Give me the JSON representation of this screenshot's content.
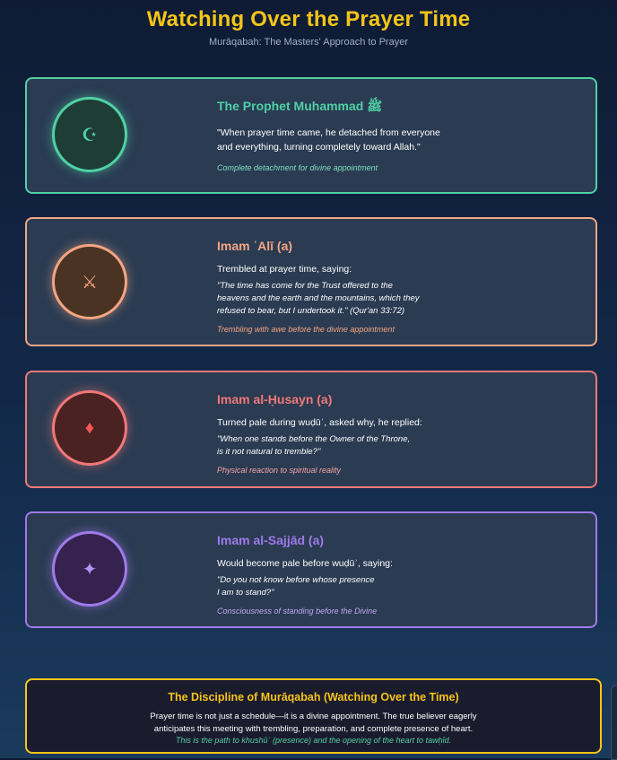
{
  "header": {
    "title": "Watching Over the Prayer Time",
    "subtitle": "Murāqabah: The Masters' Approach to Prayer"
  },
  "colors": {
    "gold": "#f5c518",
    "prophet": "#4fd1a5",
    "ali": "#f4a582",
    "husayn": "#f17878",
    "sajjad": "#9f7aea"
  },
  "cards": [
    {
      "icon": "crescent-star-icon",
      "glyph": "☪",
      "name": "The Prophet Muhammad ﷺ",
      "lead_lines": [
        "\"When prayer time came, he detached from everyone",
        "and everything, turning completely toward Allah.\""
      ],
      "quote_lines": [],
      "note": "Complete detachment for divine appointment"
    },
    {
      "icon": "crossed-swords-icon",
      "glyph": "⚔",
      "name": "Imam ʿAlī (a)",
      "lead_lines": [
        "Trembled at prayer time, saying:"
      ],
      "quote_lines": [
        "\"The time has come for the Trust offered to the",
        "heavens and the earth and the mountains, which they",
        "refused to bear, but I undertook it.\" (Qur'an 33:72)"
      ],
      "note": "Trembling with awe before the divine appointment"
    },
    {
      "icon": "diamond-icon",
      "glyph": "♦",
      "name": "Imam al-Ḥusayn (a)",
      "lead_lines": [
        "Turned pale during wuḍūʾ, asked why, he replied:"
      ],
      "quote_lines": [
        "\"When one stands before the Owner of the Throne,",
        "is it not natural to tremble?\""
      ],
      "note": "Physical reaction to spiritual reality"
    },
    {
      "icon": "sparkle-icon",
      "glyph": "✦",
      "name": "Imam al-Sajjād (a)",
      "lead_lines": [
        "Would become pale before wuḍūʾ, saying:"
      ],
      "quote_lines": [
        "\"Do you not know before whose presence",
        "I am to stand?\""
      ],
      "note": "Consciousness of standing before the Divine"
    }
  ],
  "discipline": {
    "title": "The Discipline of Murāqabah (Watching Over the Time)",
    "body_lines": [
      "Prayer time is not just a schedule—it is a divine appointment. The true believer eagerly",
      "anticipates this meeting with trembling, preparation, and complete presence of heart."
    ],
    "footer": "This is the path to khushūʿ (presence) and the opening of the heart to tawḥīd."
  }
}
